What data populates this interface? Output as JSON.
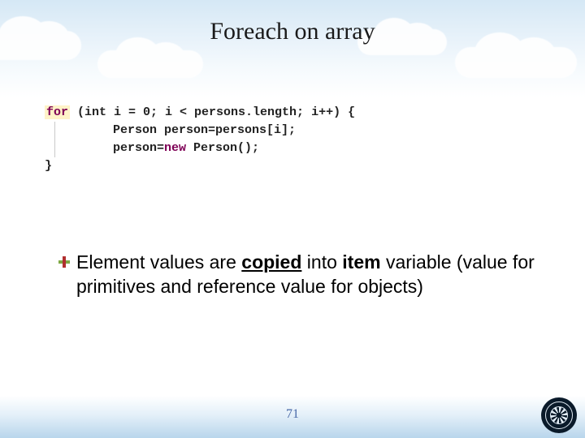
{
  "title": "Foreach on array",
  "code": {
    "for_kw": "for",
    "for_rest": " (int i = 0; i < persons.length; i++) {",
    "line2a": "Person person=persons[i];",
    "line3a": "person=",
    "new_kw": "new",
    "line3b": " Person();",
    "close": "}"
  },
  "bullet": {
    "pre": "Element values are ",
    "copied": "copied",
    "mid": " into ",
    "item": "item",
    "post1": " variable (value for primitives and reference value for objects)"
  },
  "page_number": "71"
}
